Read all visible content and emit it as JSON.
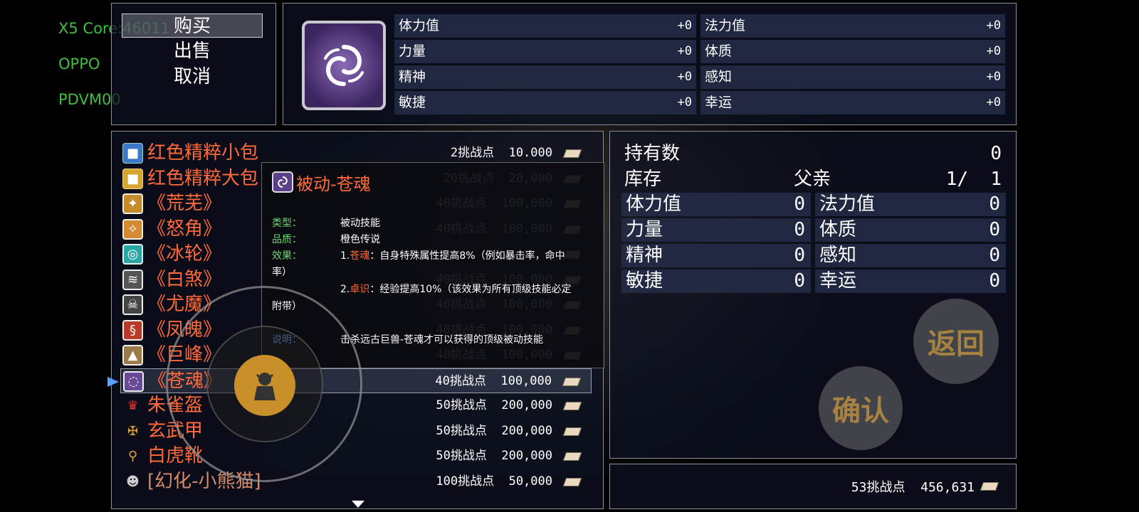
{
  "debug": [
    "X5 Core:46011",
    "OPPO",
    "PDVM00"
  ],
  "commands": [
    {
      "label": "购买",
      "selected": true
    },
    {
      "label": "出售",
      "selected": false
    },
    {
      "label": "取消",
      "selected": false
    }
  ],
  "equip_stats": {
    "left": [
      {
        "label": "体力值",
        "value": "+0"
      },
      {
        "label": "力量",
        "value": "+0"
      },
      {
        "label": "精神",
        "value": "+0"
      },
      {
        "label": "敏捷",
        "value": "+0"
      }
    ],
    "right": [
      {
        "label": "法力值",
        "value": "+0"
      },
      {
        "label": "体质",
        "value": "+0"
      },
      {
        "label": "感知",
        "value": "+0"
      },
      {
        "label": "幸运",
        "value": "+0"
      }
    ]
  },
  "items": [
    {
      "name": "红色精粹小包",
      "price": "2挑战点  10.000",
      "icon": "blue-cube-icon",
      "selected": false,
      "faded": false
    },
    {
      "name": "红色精粹大包",
      "price": "20挑战点  20,000",
      "icon": "gold-cube-icon",
      "selected": false,
      "faded": true
    },
    {
      "name": "《荒芜》",
      "price": "40挑战点  100,000",
      "icon": "skill-huangwu-icon",
      "selected": false,
      "faded": true
    },
    {
      "name": "《怒角》",
      "price": "40挑战点  100,000",
      "icon": "skill-nujiao-icon",
      "selected": false,
      "faded": true
    },
    {
      "name": "《冰轮》",
      "price": "",
      "icon": "skill-binglun-icon",
      "selected": false,
      "faded": true
    },
    {
      "name": "《白煞》",
      "price": "40挑战点  100,000",
      "icon": "skill-baisha-icon",
      "selected": false,
      "faded": true
    },
    {
      "name": "《尤魔》",
      "price": "40挑战点  100,000",
      "icon": "skill-youmo-icon",
      "selected": false,
      "faded": true
    },
    {
      "name": "《凤魄》",
      "price": "40挑战点  100,000",
      "icon": "skill-fengpo-icon",
      "selected": false,
      "faded": true
    },
    {
      "name": "《巨峰》",
      "price": "40挑战点  100,000",
      "icon": "skill-jufeng-icon",
      "selected": false,
      "faded": true
    },
    {
      "name": "《苍魂》",
      "price": "40挑战点  100,000",
      "icon": "skill-canghun-icon",
      "selected": true,
      "faded": false
    },
    {
      "name": "朱雀盔",
      "price": "50挑战点  200,000",
      "icon": "helmet-icon",
      "selected": false,
      "faded": false
    },
    {
      "name": "玄武甲",
      "price": "50挑战点  200,000",
      "icon": "armor-icon",
      "selected": false,
      "faded": false
    },
    {
      "name": "白虎靴",
      "price": "50挑战点  200,000",
      "icon": "boots-icon",
      "selected": false,
      "faded": false
    },
    {
      "name": "[幻化-小熊猫]",
      "price": "100挑战点  50,000",
      "icon": "panda-icon",
      "selected": false,
      "faded": false
    }
  ],
  "tooltip": {
    "title": "被动-苍魂",
    "type_label": "类型：",
    "type_value": "被动技能",
    "quality_label": "品质：",
    "quality_value": "橙色传说",
    "effect_label": "效果：",
    "effect1_num": "1.",
    "effect1_key": "苍魂",
    "effect1_text": "：自身特殊属性提高8%（例如暴击率，命中",
    "effect1_tail": "率）",
    "effect2_num": "2.",
    "effect2_key": "卓识",
    "effect2_text": "：经验提高10%（该效果为所有顶级技能必定",
    "effect2_tail": "附带）",
    "note_label": "说明：",
    "note_value": "击杀远古巨兽-苍魂才可以获得的顶级被动技能"
  },
  "info": {
    "owned_label": "持有数",
    "owned_value": "0",
    "stock_label": "库存",
    "stock_who": "父亲",
    "stock_value": "1/  1",
    "stats_left": [
      {
        "label": "体力值",
        "value": "0"
      },
      {
        "label": "力量",
        "value": "0"
      },
      {
        "label": "精神",
        "value": "0"
      },
      {
        "label": "敏捷",
        "value": "0"
      }
    ],
    "stats_right": [
      {
        "label": "法力值",
        "value": "0"
      },
      {
        "label": "体质",
        "value": "0"
      },
      {
        "label": "感知",
        "value": "0"
      },
      {
        "label": "幸运",
        "value": "0"
      }
    ]
  },
  "currency": "53挑战点  456,631",
  "buttons": {
    "back": "返回",
    "confirm": "确认"
  },
  "colors": {
    "item_name": "#ff6a3a",
    "debug": "#3fbf3f",
    "joystick_knob": "#c9902a"
  }
}
